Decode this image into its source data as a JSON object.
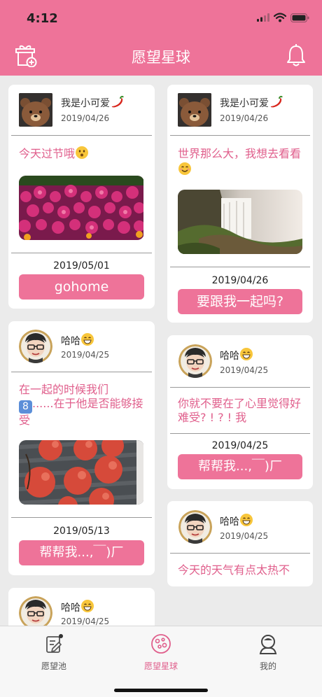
{
  "status": {
    "time": "4:12"
  },
  "header": {
    "title": "愿望星球"
  },
  "cards": [
    {
      "user": "我是小可爱",
      "user_emoji": "chili-pepper",
      "post_date": "2019/04/26",
      "message": "今天过节哦",
      "message_emoji": "hushed-face",
      "photo": "pink-flowers",
      "wish_date": "2019/05/01",
      "wish": "gohome"
    },
    {
      "user": "我是小可爱",
      "user_emoji": "chili-pepper",
      "post_date": "2019/04/26",
      "message": "世界那么大，我想去看看",
      "message_emoji": "smiling-face",
      "photo": "waterfall",
      "wish_date": "2019/04/26",
      "wish": "要跟我一起吗?"
    },
    {
      "user": "哈哈",
      "user_emoji": "grinning-face",
      "post_date": "2019/04/25",
      "message_part1": "在一起的时候我们",
      "message_keycap": "8",
      "message_part2": "......在于他是否能够接受",
      "photo": "lychees",
      "wish_date": "2019/05/13",
      "wish": "帮帮我...,￣)厂"
    },
    {
      "user": "哈哈",
      "user_emoji": "grinning-face",
      "post_date": "2019/04/25",
      "message": "你就不要在了心里觉得好难受? ! ? ! 我",
      "wish_date": "2019/04/25",
      "wish": "帮帮我...,￣)厂"
    },
    {
      "user": "哈哈",
      "user_emoji": "grinning-face",
      "post_date": "2019/04/25",
      "message": "今天的天气有点太热不"
    },
    {
      "user": "哈哈",
      "user_emoji": "grinning-face",
      "post_date": "2019/04/25"
    }
  ],
  "tabbar": {
    "tabs": [
      {
        "label": "愿望池",
        "icon": "note-icon"
      },
      {
        "label": "愿望星球",
        "icon": "planet-icon"
      },
      {
        "label": "我的",
        "icon": "profile-icon"
      }
    ],
    "active": "愿望星球"
  },
  "colors": {
    "brand_pink": "#ee7399",
    "text_pink": "#e05f8c"
  }
}
